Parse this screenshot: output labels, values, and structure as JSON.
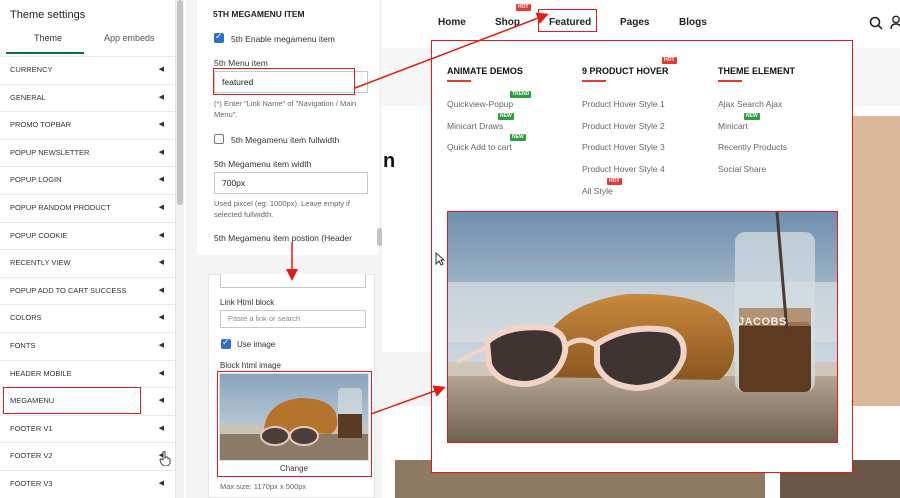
{
  "sidebar": {
    "title": "Theme settings",
    "tabs": [
      {
        "label": "Theme",
        "active": true
      },
      {
        "label": "App embeds",
        "active": false
      }
    ],
    "items": [
      {
        "label": "CURRENCY"
      },
      {
        "label": "GENERAL"
      },
      {
        "label": "PROMO TOPBAR"
      },
      {
        "label": "POPUP NEWSLETTER"
      },
      {
        "label": "POPUP LOGIN"
      },
      {
        "label": "POPUP RANDOM PRODUCT"
      },
      {
        "label": "POPUP COOKIE"
      },
      {
        "label": "RECENTLY VIEW"
      },
      {
        "label": "POPUP ADD TO CART SUCCESS"
      },
      {
        "label": "COLORS"
      },
      {
        "label": "FONTS"
      },
      {
        "label": "HEADER MOBILE"
      },
      {
        "label": "MEGAMENU"
      },
      {
        "label": "FOOTER V1"
      },
      {
        "label": "FOOTER V2"
      },
      {
        "label": "FOOTER V3"
      }
    ],
    "chevron": "◀"
  },
  "panel": {
    "heading": "5th MEGAMENU ITEM",
    "enable_label": "5th Enable megamenu item",
    "menu_item_label": "5th Menu item",
    "menu_item_value": "featured",
    "menu_item_help": "(*) Enter \"Link Name\" of \"Navigation / Main Menu\".",
    "fullwidth_label": "5th Megamenu item fullwidth",
    "width_label": "5th Megamenu item width",
    "width_value": "700px",
    "width_help": "Used pixcel (eg: 1000px). Leave empty if selected fullwidth.",
    "position_label": "5th Megamenu item postion (Header",
    "link_html_label": "Link Html block",
    "link_html_placeholder": "Paste a link or search",
    "use_image_label": "Use image",
    "block_image_label": "Block html image",
    "change_button": "Change",
    "max_size": "Max size: 1170px x 500px"
  },
  "nav": {
    "items": [
      {
        "label": "Home"
      },
      {
        "label": "Shop",
        "badge": "HOT"
      },
      {
        "label": "Featured"
      },
      {
        "label": "Pages"
      },
      {
        "label": "Blogs"
      }
    ]
  },
  "mega": {
    "columns": [
      {
        "title": "ANIMATE DEMOS",
        "links": [
          {
            "label": "Quickview-Popup",
            "badge": "TREND"
          },
          {
            "label": "Minicart Draws",
            "badge": "NEW"
          },
          {
            "label": "Quick Add to cart",
            "badge": "NEW"
          }
        ]
      },
      {
        "title": "9 PRODUCT HOVER",
        "badge": "HOT",
        "links": [
          {
            "label": "Product Hover Style 1"
          },
          {
            "label": "Product Hover Style 2"
          },
          {
            "label": "Product Hover Style 3"
          },
          {
            "label": "Product Hover Style 4"
          },
          {
            "label": "All Style",
            "badge": "HOT"
          }
        ]
      },
      {
        "title": "THEME ELEMENT",
        "links": [
          {
            "label": "Ajax Search Ajax"
          },
          {
            "label": "Minicart",
            "badge": "NEW"
          },
          {
            "label": "Recently Products"
          },
          {
            "label": "Social Share"
          }
        ]
      }
    ],
    "image_caption": "JACOBS"
  },
  "colors": {
    "accent_red": "#e31b1b",
    "check_blue": "#2c6ecb",
    "tab_green": "#0b6e5a",
    "badge_hot": "#e53935",
    "badge_new": "#2e9e44"
  }
}
